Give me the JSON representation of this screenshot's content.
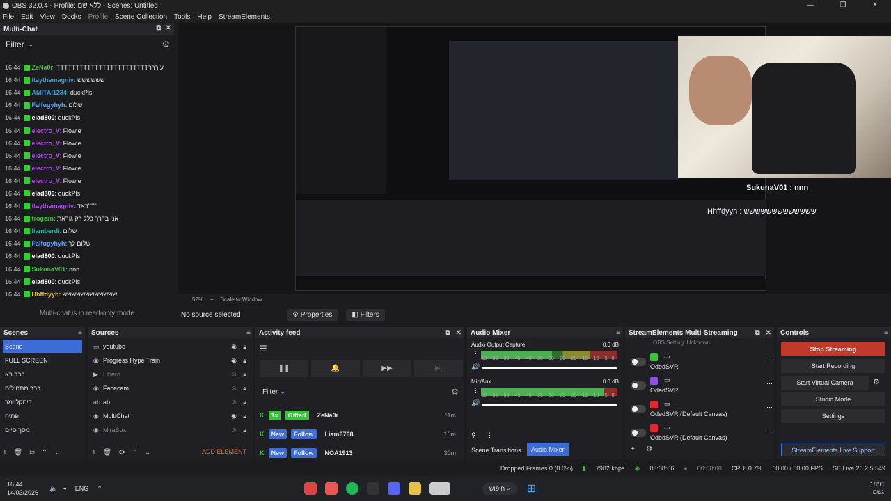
{
  "window": {
    "title": "OBS 32.0.4 - Profile: ללא שם - Scenes: Untitled",
    "min": "—",
    "max": "❐",
    "close": "✕"
  },
  "menu": [
    "File",
    "Edit",
    "View",
    "Docks",
    "Profile",
    "Scene Collection",
    "Tools",
    "Help",
    "StreamElements"
  ],
  "multichat": {
    "title": "Multi-Chat",
    "filter": "Filter",
    "readonly": "Multi-chat is in read-only mode",
    "messages": [
      {
        "time": "16:44",
        "user": "ZeNa0r:",
        "text": "TTTTTTTTTTTTTTTTTTTTTTTTעוררר",
        "color": "#3fbf3f"
      },
      {
        "time": "16:44",
        "user": "itaythemagniv:",
        "text": "שששששש",
        "color": "#3a9fd8"
      },
      {
        "time": "16:44",
        "user": "AMITAI1234:",
        "text": "duckPls",
        "color": "#3a9fd8"
      },
      {
        "time": "16:44",
        "user": "Falfugyhyh:",
        "text": "שלום",
        "color": "#5aa0ff"
      },
      {
        "time": "16:44",
        "user": "elad800:",
        "text": "duckPls",
        "color": "#ffffff"
      },
      {
        "time": "16:44",
        "user": "electro_V:",
        "text": "Flowie",
        "color": "#a64ee0"
      },
      {
        "time": "16:44",
        "user": "electro_V:",
        "text": "Flowie",
        "color": "#a64ee0"
      },
      {
        "time": "16:44",
        "user": "electro_V:",
        "text": "Flowie",
        "color": "#a64ee0"
      },
      {
        "time": "16:44",
        "user": "electro_V:",
        "text": "Flowie",
        "color": "#a64ee0"
      },
      {
        "time": "16:44",
        "user": "electro_V:",
        "text": "Flowie",
        "color": "#a64ee0"
      },
      {
        "time": "16:44",
        "user": "elad800:",
        "text": "duckPls",
        "color": "#ffffff"
      },
      {
        "time": "16:44",
        "user": "itaythemagniv:",
        "text": "דאד''''''''",
        "color": "#a64ee0"
      },
      {
        "time": "16:44",
        "user": "trogern:",
        "text": "אני בדרך כלל רק גוראת",
        "color": "#3fbf3f"
      },
      {
        "time": "16:44",
        "user": "liamberdi:",
        "text": "שלום",
        "color": "#2fb8a8"
      },
      {
        "time": "16:44",
        "user": "Falfugyhyh:",
        "text": "שלום לך",
        "color": "#5aa0ff"
      },
      {
        "time": "16:44",
        "user": "elad800:",
        "text": "duckPls",
        "color": "#ffffff"
      },
      {
        "time": "16:44",
        "user": "SukunaV01:",
        "text": "nnn",
        "color": "#3fbf3f"
      },
      {
        "time": "16:44",
        "user": "elad800:",
        "text": "duckPls",
        "color": "#ffffff"
      },
      {
        "time": "16:44",
        "user": "Hhffdyyh:",
        "text": "שששששששששששש",
        "color": "#d8c23a"
      }
    ]
  },
  "overlay": {
    "line1": "SukunaV01 : nnn",
    "line2": "Hhffdyyh : ששששששששששששש"
  },
  "preview": {
    "zoom": "52%",
    "scale": "Scale to Window"
  },
  "context": {
    "source": "No source selected",
    "properties": "Properties",
    "filters": "Filters"
  },
  "scenes": {
    "title": "Scenes",
    "items": [
      "Scene",
      "FULL SCREEN",
      "כבר בא",
      "כבר מתחילים",
      "דיסקליימר",
      "פתיח",
      "מסך סיום"
    ]
  },
  "sources": {
    "title": "Sources",
    "add": "ADD ELEMENT",
    "items": [
      {
        "name": "youtube",
        "icon": "▭",
        "visible": true
      },
      {
        "name": "Progress Hype Train",
        "icon": "◉",
        "visible": true
      },
      {
        "name": "Libero",
        "icon": "▶",
        "visible": false
      },
      {
        "name": "Facecam",
        "icon": "◉",
        "visible": false
      },
      {
        "name": "ab",
        "icon": "ab",
        "visible": false
      },
      {
        "name": "MultiChat",
        "icon": "◉",
        "visible": true
      },
      {
        "name": "MiraBox",
        "icon": "◉",
        "visible": false
      }
    ]
  },
  "activity": {
    "title": "Activity feed",
    "filter": "Filter",
    "rows": [
      {
        "tag": "1x",
        "type": "Gifted",
        "user": "ZeNa0r",
        "time": "11m",
        "tagcolor": "#3fbf3f"
      },
      {
        "tag": "New",
        "type": "Follow",
        "user": "Liam6768",
        "time": "16m",
        "tagcolor": "#3d6cd7"
      },
      {
        "tag": "New",
        "type": "Follow",
        "user": "NOA1913",
        "time": "30m",
        "tagcolor": "#3d6cd7"
      }
    ]
  },
  "mixer": {
    "title": "Audio Mixer",
    "ch1": "Audio Output Capture",
    "ch1db": "0.0 dB",
    "ch2": "Mic/Aux",
    "ch2db": "0.0 dB",
    "ticks": [
      "-60",
      "-55",
      "-50",
      "-45",
      "-40",
      "-35",
      "-30",
      "-25",
      "-20",
      "-15",
      "-10",
      "-5",
      "0"
    ],
    "ch1level": 0.52,
    "ch2level": 0.9,
    "tab1": "Scene Transitions",
    "tab2": "Audio Mixer"
  },
  "multistream": {
    "title": "StreamElements Multi-Streaming",
    "status": "OBS Setting: Unknown",
    "rows": [
      {
        "name": "OdedSVR",
        "platform": "kick",
        "color": "#3fbf3f"
      },
      {
        "name": "OdedSVR",
        "platform": "twitch",
        "color": "#8f4fe0"
      },
      {
        "name": "OdedSVR (Default Canvas)",
        "platform": "youtube",
        "color": "#e02a2a"
      },
      {
        "name": "OdedSVR (Default Canvas)",
        "platform": "youtube",
        "color": "#e02a2a"
      }
    ]
  },
  "controls": {
    "title": "Controls",
    "stop": "Stop Streaming",
    "record": "Start Recording",
    "vcam": "Start Virtual Camera",
    "studio": "Studio Mode",
    "settings": "Settings",
    "support": "StreamElements Live Support"
  },
  "status": {
    "dropped": "Dropped Frames 0 (0.0%)",
    "kbps": "7982 kbps",
    "live": "03:08:06",
    "rec": "00:00:00",
    "cpu": "CPU: 0.7%",
    "fps": "60.00 / 60.00 FPS",
    "ver": "SE.Live 26.2.5.549"
  },
  "taskbar": {
    "time": "16:44",
    "date": "14/03/2026",
    "lang": "ENG",
    "search": "חיפוש",
    "weather": "18°C",
    "weather2": "גשם"
  }
}
